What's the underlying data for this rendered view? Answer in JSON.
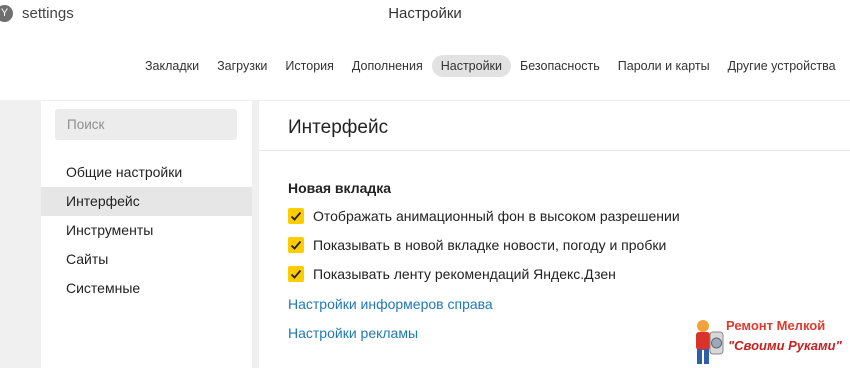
{
  "address": {
    "text": "settings",
    "icon": "yandex-browser-icon"
  },
  "window_title": "Настройки",
  "nav": {
    "tabs": [
      {
        "label": "Закладки"
      },
      {
        "label": "Загрузки"
      },
      {
        "label": "История"
      },
      {
        "label": "Дополнения"
      },
      {
        "label": "Настройки"
      },
      {
        "label": "Безопасность"
      },
      {
        "label": "Пароли и карты"
      },
      {
        "label": "Другие устройства"
      }
    ],
    "active_index": 4
  },
  "sidebar": {
    "search_placeholder": "Поиск",
    "items": [
      {
        "label": "Общие настройки"
      },
      {
        "label": "Интерфейс"
      },
      {
        "label": "Инструменты"
      },
      {
        "label": "Сайты"
      },
      {
        "label": "Системные"
      }
    ],
    "active_index": 1
  },
  "main": {
    "title": "Интерфейс",
    "section_title": "Новая вкладка",
    "options": [
      {
        "label": "Отображать анимационный фон в высоком разрешении",
        "checked": true
      },
      {
        "label": "Показывать в новой вкладке новости, погоду и пробки",
        "checked": true
      },
      {
        "label": "Показывать ленту рекомендаций Яндекс.Дзен",
        "checked": true
      }
    ],
    "links": [
      {
        "label": "Настройки информеров справа"
      },
      {
        "label": "Настройки рекламы"
      }
    ]
  },
  "watermark": {
    "line1": "Ремонт Мелкой",
    "line2": "\"Своими Руками\""
  },
  "colors": {
    "checkbox": "#ffcc00",
    "link": "#1f78b4",
    "active_tab_bg": "#e2e2e2"
  }
}
